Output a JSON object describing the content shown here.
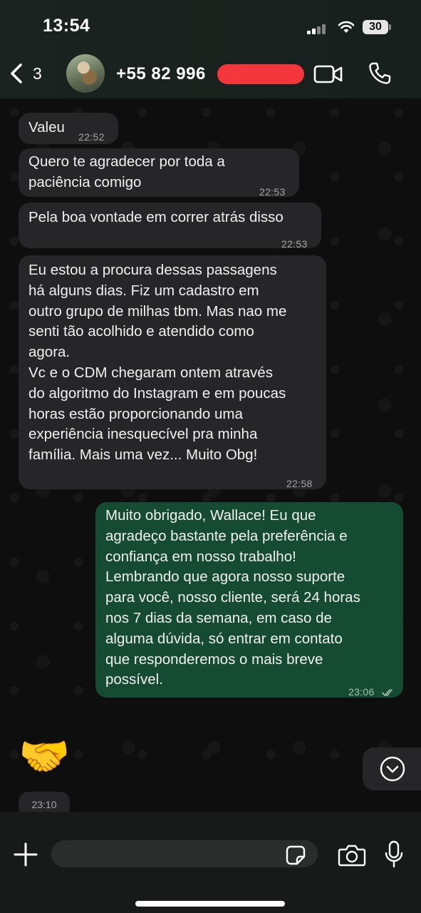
{
  "status_bar": {
    "time": "13:54",
    "battery": "30"
  },
  "header": {
    "back_count": "3",
    "contact_name": "+55 82 996",
    "icons": [
      "back-chevron-icon",
      "video-call-icon",
      "phone-call-icon"
    ]
  },
  "messages": [
    {
      "direction": "incoming",
      "text": "Valeu",
      "time": "22:52"
    },
    {
      "direction": "incoming",
      "text": "Quero te agradecer por toda a\npaciência comigo",
      "time": "22:53"
    },
    {
      "direction": "incoming",
      "text": "Pela boa vontade em correr atrás disso",
      "time": "22:53"
    },
    {
      "direction": "incoming",
      "text": "Eu estou a procura dessas passagens\nhá alguns dias. Fiz um cadastro em\noutro grupo de milhas tbm. Mas nao me\nsenti tão acolhido e atendido como\nagora.\nVc e o CDM chegaram ontem através\ndo algoritmo do Instagram e em poucas\nhoras estão proporcionando uma\nexperiência inesquecível pra minha\nfamília. Mais uma vez... Muito Obg!",
      "time": "22:58"
    },
    {
      "direction": "outgoing",
      "text": "Muito obrigado, Wallace! Eu que\nagradeço bastante pela preferência e\nconfiança em nosso trabalho!\nLembrando que agora nosso suporte\npara você, nosso cliente, será 24 horas\nnos 7 dias da semana, em caso de\nalguma dúvida, só entrar em contato\nque responderemos o mais breve\npossível.",
      "time": "23:06",
      "status": "read"
    },
    {
      "direction": "incoming",
      "type": "emoji",
      "emoji": "🤝",
      "time": "23:10",
      "reaction": "❤️"
    }
  ],
  "input": {
    "placeholder": ""
  },
  "colors": {
    "incoming_bubble": "#262628",
    "outgoing_bubble": "#154b33",
    "header_bg": "#1b2320"
  }
}
